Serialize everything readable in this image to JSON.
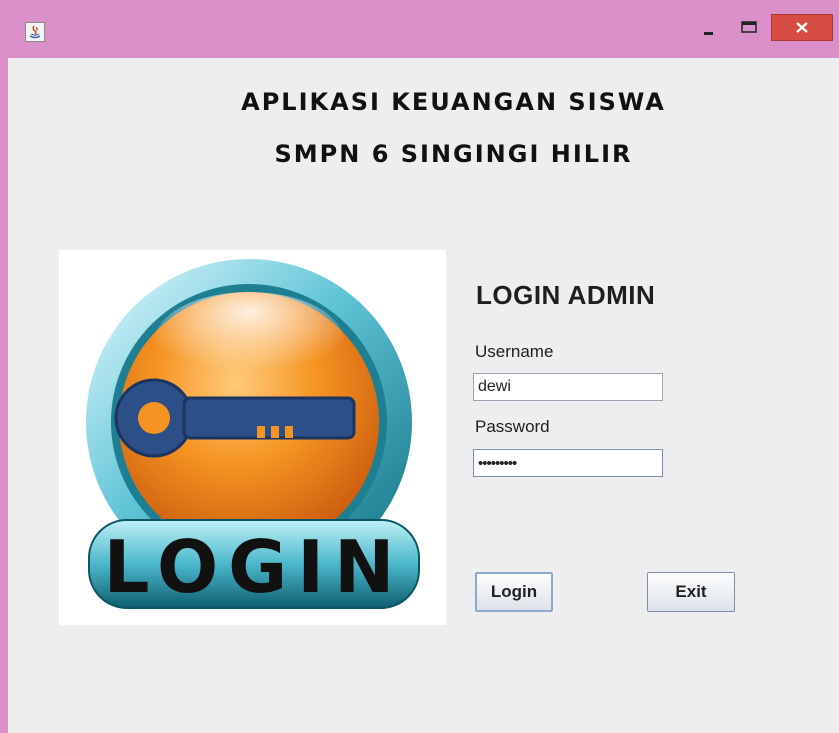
{
  "window": {
    "frame_color": "#da8fc9",
    "close_color": "#d84d43",
    "icon": "java-app-icon",
    "controls": {
      "minimize_icon": "minimize-icon",
      "maximize_icon": "maximize-icon",
      "close_icon": "close-icon"
    }
  },
  "header": {
    "title_line1": "APLIKASI KEUANGAN SISWA",
    "title_line2": "SMPN 6 SINGINGI HILIR"
  },
  "image": {
    "text": "LOGIN",
    "icon": "key-icon"
  },
  "form": {
    "heading": "LOGIN ADMIN",
    "username_label": "Username",
    "username_value": "dewi",
    "password_label": "Password",
    "password_value": "•••••••••"
  },
  "buttons": {
    "login_label": "Login",
    "exit_label": "Exit"
  }
}
